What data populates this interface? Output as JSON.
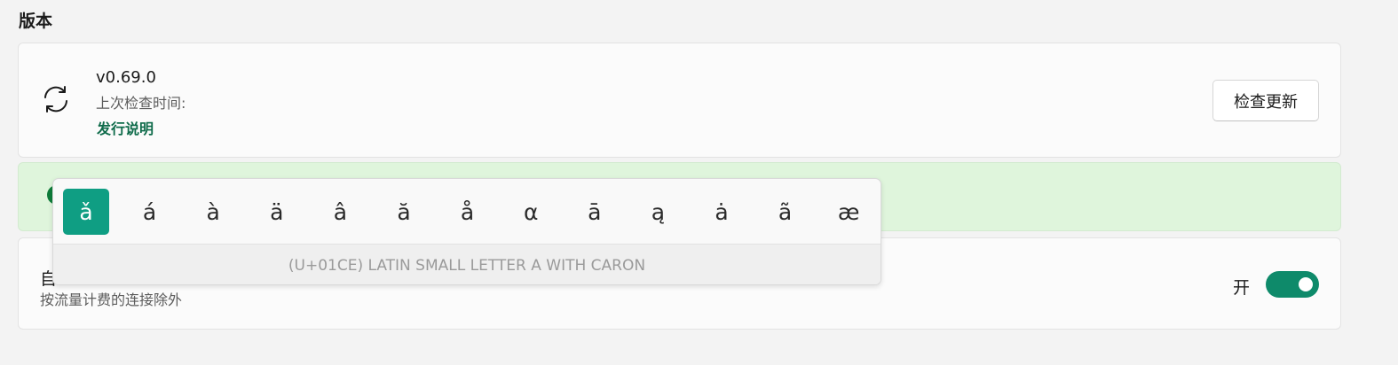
{
  "section": {
    "title": "版本"
  },
  "version_card": {
    "icon": "sync-icon",
    "version": "v0.69.0",
    "last_check_label": "上次检查时间:",
    "release_notes_label": "发行说明",
    "check_update_label": "检查更新"
  },
  "banner": {
    "icon": "success-dot-icon"
  },
  "auto_update": {
    "title": "自",
    "subtitle": "按流量计费的连接除外",
    "toggle_label": "开",
    "toggle_on": true
  },
  "char_popup": {
    "chars": [
      "ǎ",
      "á",
      "à",
      "ä",
      "â",
      "ă",
      "å",
      "α",
      "ā",
      "ą",
      "ȧ",
      "ã",
      "æ"
    ],
    "selected_index": 0,
    "description": "(U+01CE) LATIN SMALL LETTER A WITH CARON"
  },
  "colors": {
    "accent": "#0e8a6a",
    "selected_char_bg": "#0f9e83",
    "banner_bg": "#dff5dc",
    "link": "#0e6b4a"
  }
}
